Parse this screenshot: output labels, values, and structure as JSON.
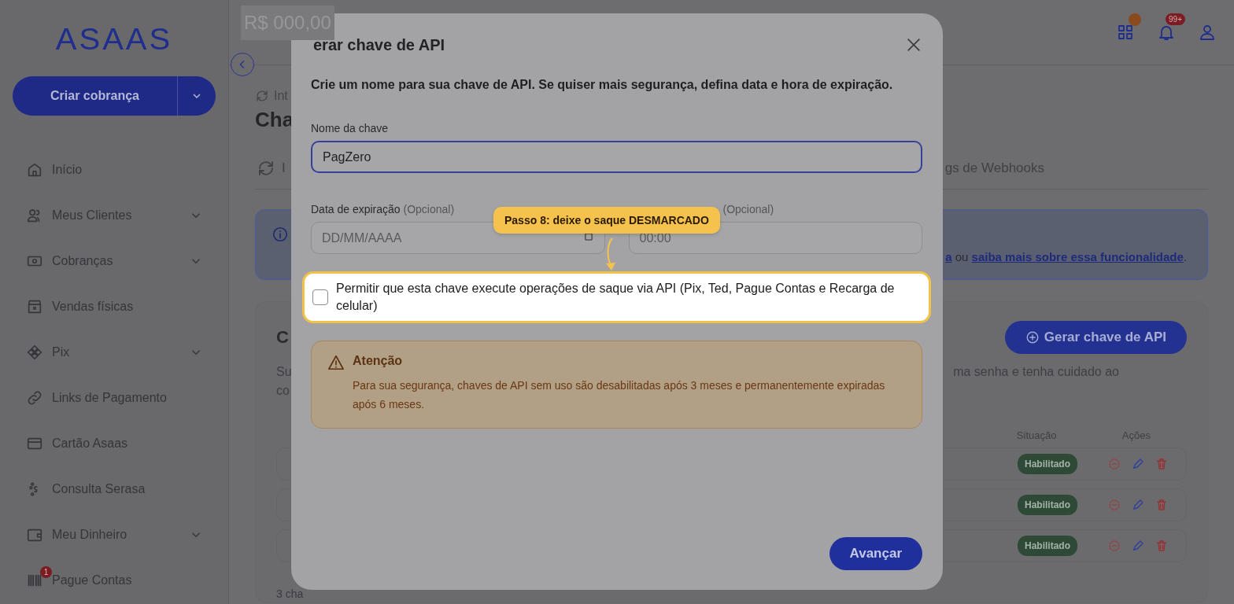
{
  "sidebar": {
    "logo": "ASAAS",
    "create_button": "Criar cobrança",
    "items": [
      {
        "label": "Início",
        "expandable": false
      },
      {
        "label": "Meus Clientes",
        "expandable": true
      },
      {
        "label": "Cobranças",
        "expandable": true
      },
      {
        "label": "Vendas físicas",
        "expandable": false
      },
      {
        "label": "Pix",
        "expandable": true
      },
      {
        "label": "Links de Pagamento",
        "expandable": false
      },
      {
        "label": "Cartão Asaas",
        "expandable": false
      },
      {
        "label": "Consulta Serasa",
        "expandable": false
      },
      {
        "label": "Meu Dinheiro",
        "expandable": true
      },
      {
        "label": "Pague Contas",
        "expandable": false,
        "badge": "1"
      }
    ]
  },
  "header": {
    "balance": "R$ 000,00",
    "notification_badge": "99+"
  },
  "page": {
    "breadcrumb": "Int",
    "title": "Cha",
    "tabs": [
      {
        "label": "I",
        "selected": false
      },
      {
        "label": "gs de Webhooks",
        "selected": false
      }
    ],
    "info": {
      "link_end": "a",
      "connector": "ou",
      "link": "saiba mais sobre essa funcionalidade",
      "end": "."
    },
    "keys_card": {
      "title": "C",
      "description_left": [
        "Su",
        "co"
      ],
      "description_right": "ma senha e tenha cuidado ao",
      "button": "Gerar chave de API",
      "columns": [
        "Situação",
        "Ações"
      ],
      "rows": [
        {
          "status": "Habilitado"
        },
        {
          "status": "Habilitado"
        },
        {
          "status": "Habilitado"
        }
      ],
      "footer": "3 cha"
    }
  },
  "modal": {
    "title": "erar chave de API",
    "intro": "Crie um nome para sua chave de API. Se quiser mais segurança, defina data e hora de expiração.",
    "name_field": {
      "label": "Nome da chave",
      "value": "PagZero"
    },
    "date_field": {
      "label": "Data de expiração",
      "hint": "(Opcional)",
      "placeholder": "DD/MM/AAAA"
    },
    "time_field": {
      "hint": "(Opcional)",
      "placeholder": "00:00"
    },
    "withdraw_checkbox": {
      "label": "Permitir que esta chave execute operações de saque via API (Pix, Ted, Pague Contas e Recarga de celular)",
      "checked": false
    },
    "warning": {
      "title": "Atenção",
      "text": "Para sua segurança, chaves de API sem uso são desabilitadas após 3 meses e permanentemente expiradas após 6 meses."
    },
    "submit_button": "Avançar",
    "tooltip": "Passo 8: deixe o saque DESMARCADO"
  }
}
